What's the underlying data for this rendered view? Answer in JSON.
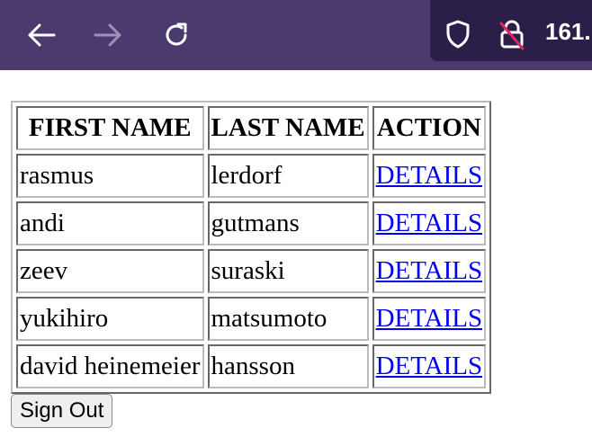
{
  "browser": {
    "back_icon": "arrow-left-icon",
    "forward_icon": "arrow-right-icon",
    "reload_icon": "reload-icon",
    "shield_icon": "shield-icon",
    "lock_icon": "lock-slash-icon",
    "url_text": "161.",
    "toolbar_color": "#4a3a6e",
    "urlbar_color": "#2b1e48"
  },
  "table": {
    "headers": [
      "FIRST NAME",
      "LAST NAME",
      "ACTION"
    ],
    "rows": [
      {
        "first": "rasmus",
        "last": "lerdorf",
        "action": "DETAILS"
      },
      {
        "first": "andi",
        "last": "gutmans",
        "action": "DETAILS"
      },
      {
        "first": "zeev",
        "last": "suraski",
        "action": "DETAILS"
      },
      {
        "first": "yukihiro",
        "last": "matsumoto",
        "action": "DETAILS"
      },
      {
        "first": "david heinemeier",
        "last": "hansson",
        "action": "DETAILS"
      }
    ]
  },
  "signout_label": "Sign Out"
}
